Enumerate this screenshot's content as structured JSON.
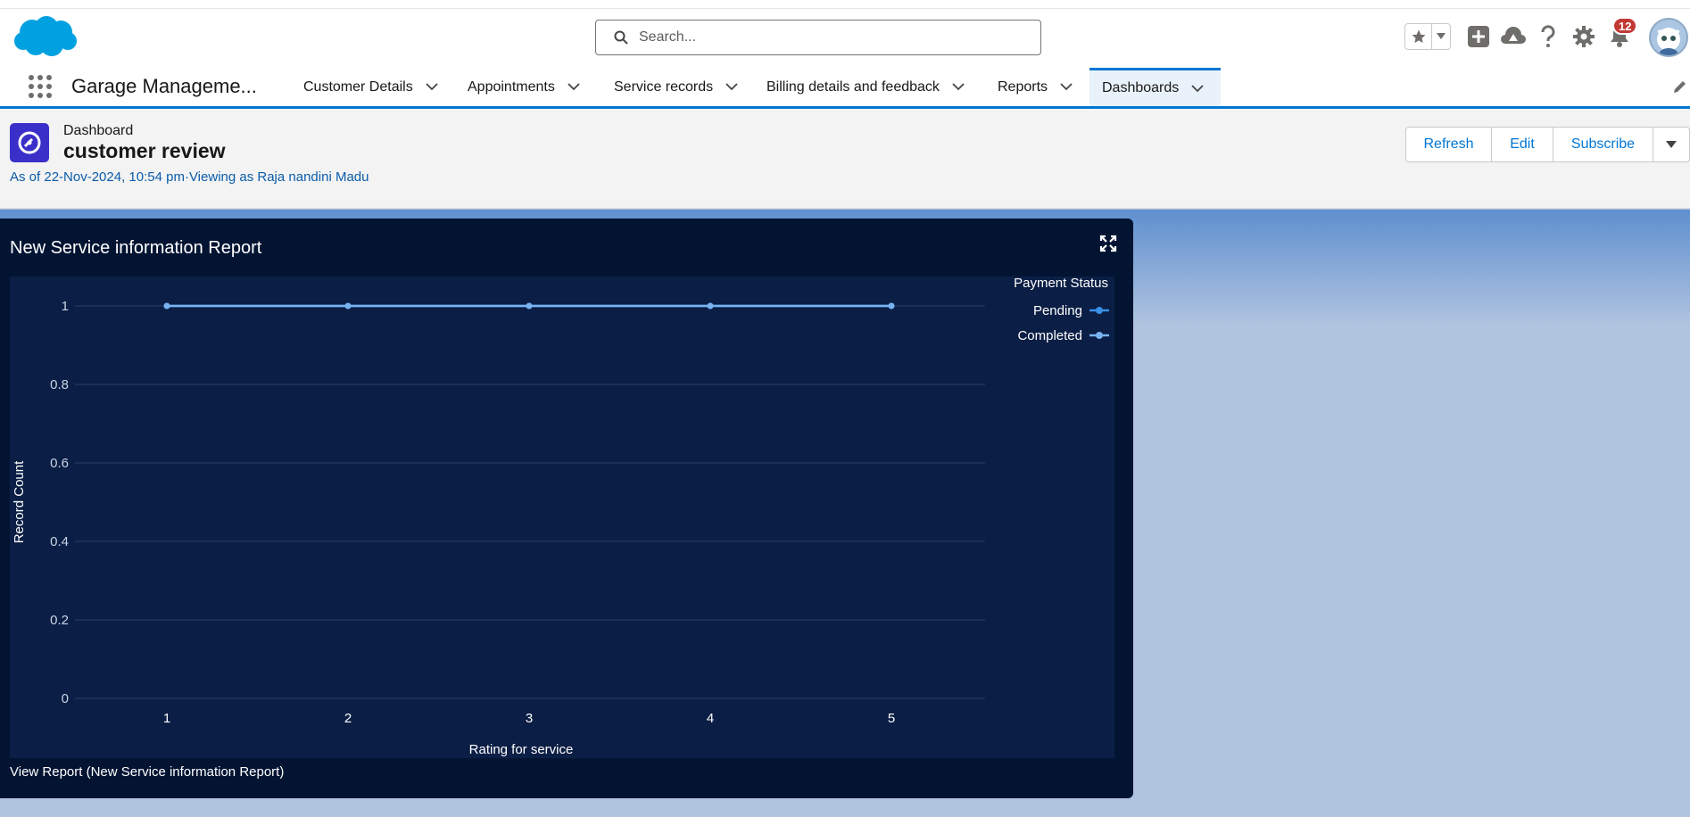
{
  "header": {
    "search_placeholder": "Search...",
    "notification_count": "12"
  },
  "nav": {
    "app_name": "Garage Manageme...",
    "items": [
      {
        "label": "Customer Details"
      },
      {
        "label": "Appointments"
      },
      {
        "label": "Service records"
      },
      {
        "label": "Billing details and feedback"
      },
      {
        "label": "Reports"
      },
      {
        "label": "Dashboards"
      }
    ],
    "active_item": "Dashboards"
  },
  "dashboard": {
    "type_label": "Dashboard",
    "title": "customer review",
    "as_of": "As of 22-Nov-2024, 10:54 pm",
    "viewing_as": "·Viewing as Raja nandini Madu",
    "buttons": {
      "refresh": "Refresh",
      "edit": "Edit",
      "subscribe": "Subscribe"
    }
  },
  "widget": {
    "title": "New Service information Report",
    "view_report": "View Report (New Service information Report)"
  },
  "chart_data": {
    "type": "line",
    "xlabel": "Rating for service",
    "ylabel": "Record Count",
    "x": [
      1,
      2,
      3,
      4,
      5
    ],
    "ylim": [
      0,
      1
    ],
    "yticks": [
      "0",
      "0.2",
      "0.4",
      "0.6",
      "0.8",
      "1"
    ],
    "xticks": [
      "1",
      "2",
      "3",
      "4",
      "5"
    ],
    "legend_title": "Payment Status",
    "legend_position": "top-right",
    "grid": true,
    "series": [
      {
        "name": "Pending",
        "values": [
          1,
          1,
          1,
          1,
          1
        ],
        "color": "#3a8ee6"
      },
      {
        "name": "Completed",
        "values": [
          1,
          1,
          1,
          1,
          1
        ],
        "color": "#78b3f0"
      }
    ]
  },
  "colors": {
    "brand_blue": "#0176d3",
    "widget_bg": "#031433",
    "chart_bg": "#0b1e45",
    "link_blue": "#0b5cab",
    "dashboard_icon": "#3b2fc9"
  }
}
